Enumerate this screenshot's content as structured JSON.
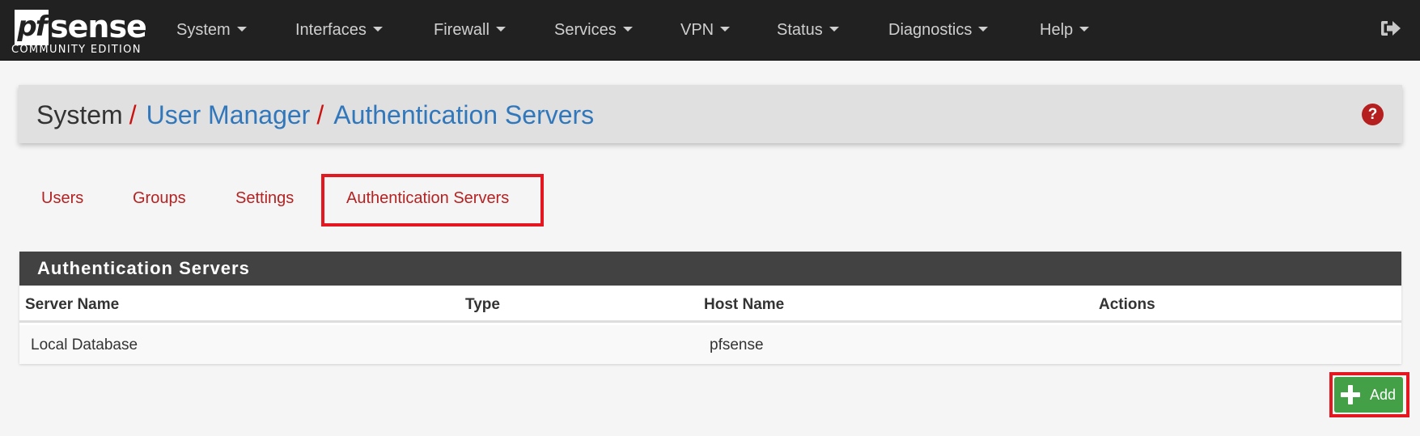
{
  "navbar": {
    "logo": {
      "mark": "pf",
      "word": "sense",
      "subtitle": "COMMUNITY EDITION"
    },
    "menu": [
      {
        "label": "System",
        "icon": "caret-down-icon"
      },
      {
        "label": "Interfaces",
        "icon": "caret-down-icon"
      },
      {
        "label": "Firewall",
        "icon": "caret-down-icon"
      },
      {
        "label": "Services",
        "icon": "caret-down-icon"
      },
      {
        "label": "VPN",
        "icon": "caret-down-icon"
      },
      {
        "label": "Status",
        "icon": "caret-down-icon"
      },
      {
        "label": "Diagnostics",
        "icon": "caret-down-icon"
      },
      {
        "label": "Help",
        "icon": "caret-down-icon"
      }
    ],
    "logout_icon": "sign-out-icon"
  },
  "breadcrumb": {
    "items": [
      "System",
      "User Manager",
      "Authentication Servers"
    ],
    "separator": "/",
    "help_icon": "?"
  },
  "tabs": [
    {
      "label": "Users",
      "active": false
    },
    {
      "label": "Groups",
      "active": false
    },
    {
      "label": "Settings",
      "active": false
    },
    {
      "label": "Authentication Servers",
      "active": true
    }
  ],
  "panel": {
    "title": "Authentication Servers",
    "columns": [
      "Server Name",
      "Type",
      "Host Name",
      "Actions"
    ],
    "rows": [
      {
        "server_name": "Local Database",
        "type": "",
        "host_name": "pfsense",
        "actions": ""
      }
    ]
  },
  "add_button": {
    "label": "Add",
    "icon": "plus-icon"
  },
  "colors": {
    "navbar_bg": "#212121",
    "link_blue": "#3177bb",
    "tab_red": "#b52222",
    "highlight_red": "#e4161f",
    "add_green": "#43a047",
    "panel_heading": "#424242"
  }
}
